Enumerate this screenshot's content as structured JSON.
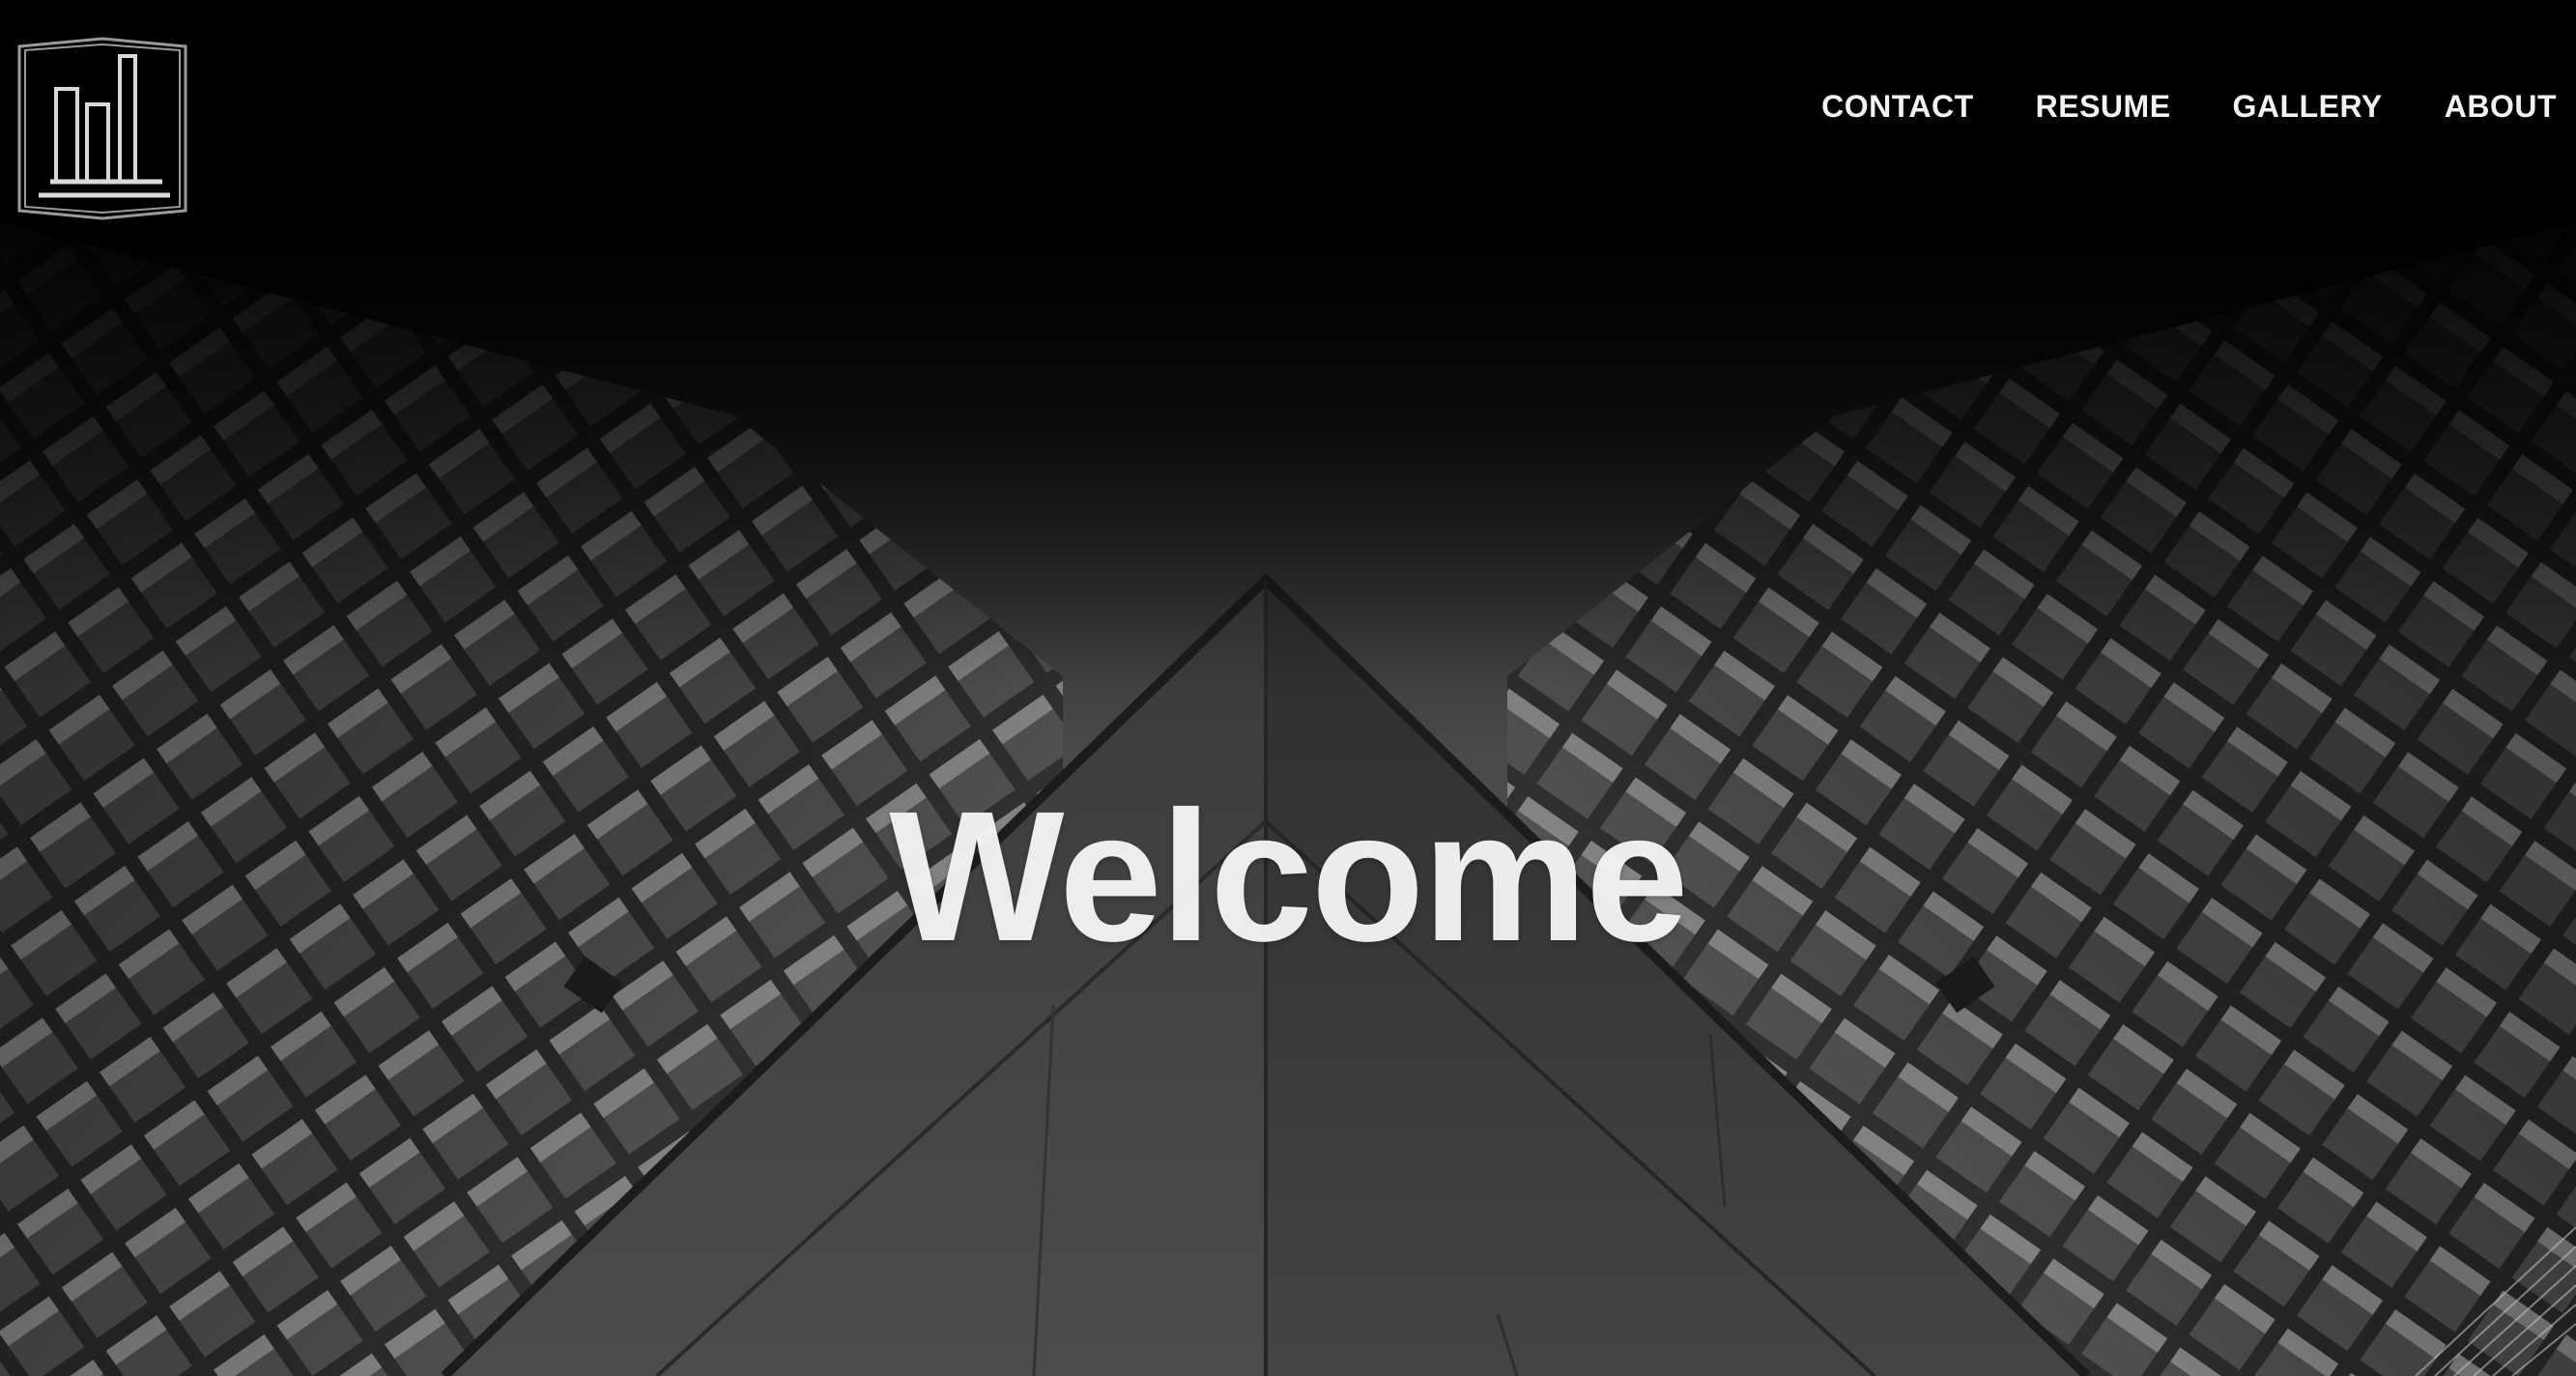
{
  "nav": {
    "items": [
      {
        "label": "CONTACT"
      },
      {
        "label": "RESUME"
      },
      {
        "label": "GALLERY"
      },
      {
        "label": "ABOUT"
      }
    ]
  },
  "hero": {
    "heading": "Welcome",
    "background_icon": "buildings-photo"
  },
  "logo": {
    "icon": "buildings-logo-icon"
  },
  "colors": {
    "background": "#000000",
    "text": "#f2f2f2"
  }
}
